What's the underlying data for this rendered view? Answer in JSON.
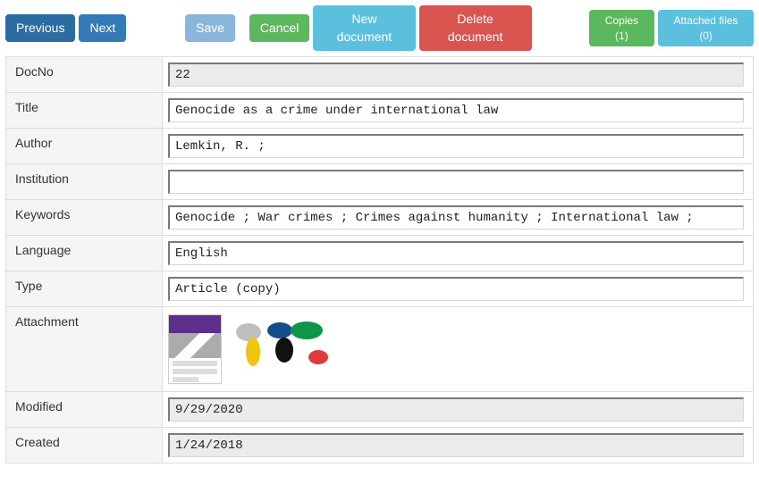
{
  "toolbar": {
    "previous": "Previous",
    "next": "Next",
    "save": "Save",
    "cancel": "Cancel",
    "new_document": "New document",
    "delete_document": "Delete document",
    "copies": "Copies (1)",
    "attached_files": "Attached files (0)"
  },
  "labels": {
    "docno": "DocNo",
    "title": "Title",
    "author": "Author",
    "institution": "Institution",
    "keywords": "Keywords",
    "language": "Language",
    "type": "Type",
    "attachment": "Attachment",
    "modified": "Modified",
    "created": "Created"
  },
  "values": {
    "docno": "22",
    "title": "Genocide as a crime under international law",
    "author": "Lemkin, R. ;",
    "institution": "",
    "keywords": "Genocide ; War crimes ; Crimes against humanity ; International law ;",
    "language": "English",
    "type": "Article (copy)",
    "modified": "9/29/2020",
    "created": "1/24/2018"
  }
}
